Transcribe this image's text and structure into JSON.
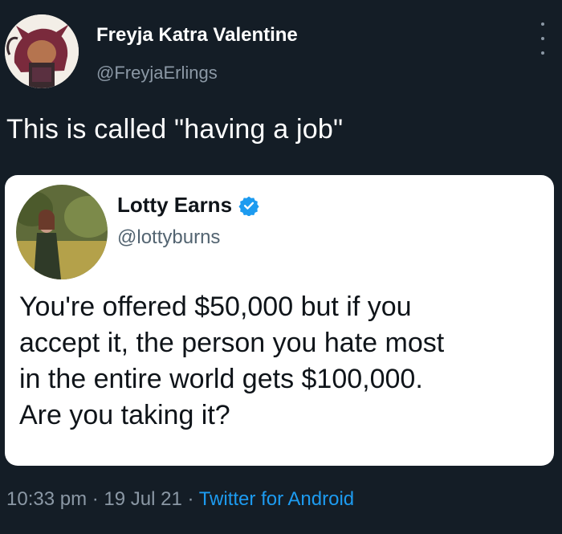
{
  "author": {
    "name": "Freyja Katra Valentine",
    "handle": "@FreyjaErlings"
  },
  "tweet_text": "This is called \"having a job\"",
  "quoted_tweet": {
    "author_name": "Lotty Earns",
    "author_handle": "@lottyburns",
    "verified": true,
    "body_lines": [
      "You're offered $50,000 but if you",
      "accept it, the person you hate most",
      "in the entire world gets $100,000.",
      "Are you taking it?"
    ]
  },
  "meta": {
    "time": "10:33 pm",
    "separator": " · ",
    "date": "19 Jul 21",
    "source": "Twitter for Android"
  },
  "icons": {
    "more": "more-vertical-icon",
    "verified": "verified-badge-icon"
  },
  "colors": {
    "background": "#141d26",
    "handle_grey": "#8b98a5",
    "link_blue": "#1d9bf0",
    "quote_bg": "#ffffff"
  }
}
